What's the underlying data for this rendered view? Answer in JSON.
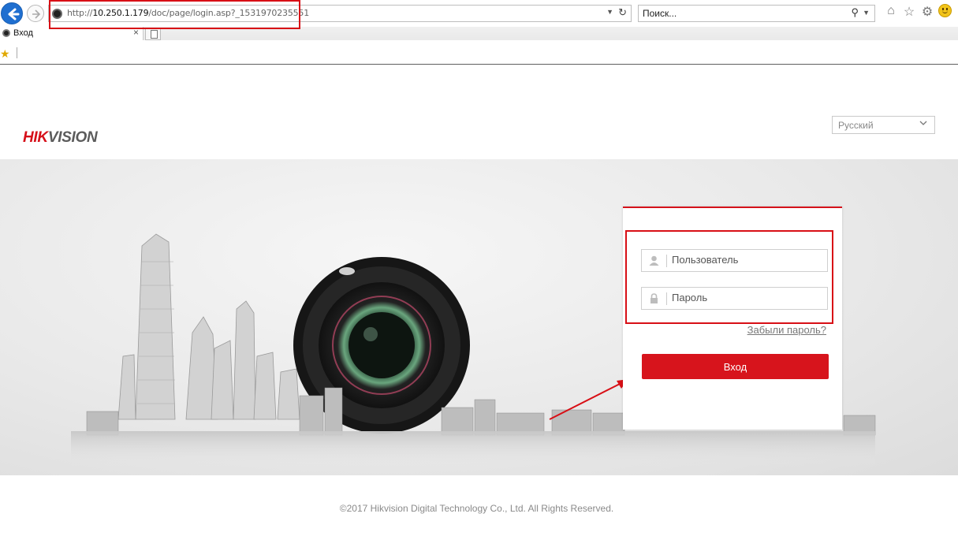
{
  "browser": {
    "url_prefix": "http://",
    "url_host": "10.250.1.179",
    "url_path": "/doc/page/login.asp?_1531970235551",
    "search_placeholder": "Поиск...",
    "tab_title": "Вход"
  },
  "page": {
    "logo_hik": "HIK",
    "logo_vision": "VISION",
    "language": "Русский",
    "username_placeholder": "Пользователь",
    "password_placeholder": "Пароль",
    "forgot_password": "Забыли пароль?",
    "login_button": "Вход",
    "footer": "©2017 Hikvision Digital Technology Co., Ltd. All Rights Reserved."
  },
  "colors": {
    "brand_red": "#d7141c",
    "annotation_red": "#d80f16"
  }
}
